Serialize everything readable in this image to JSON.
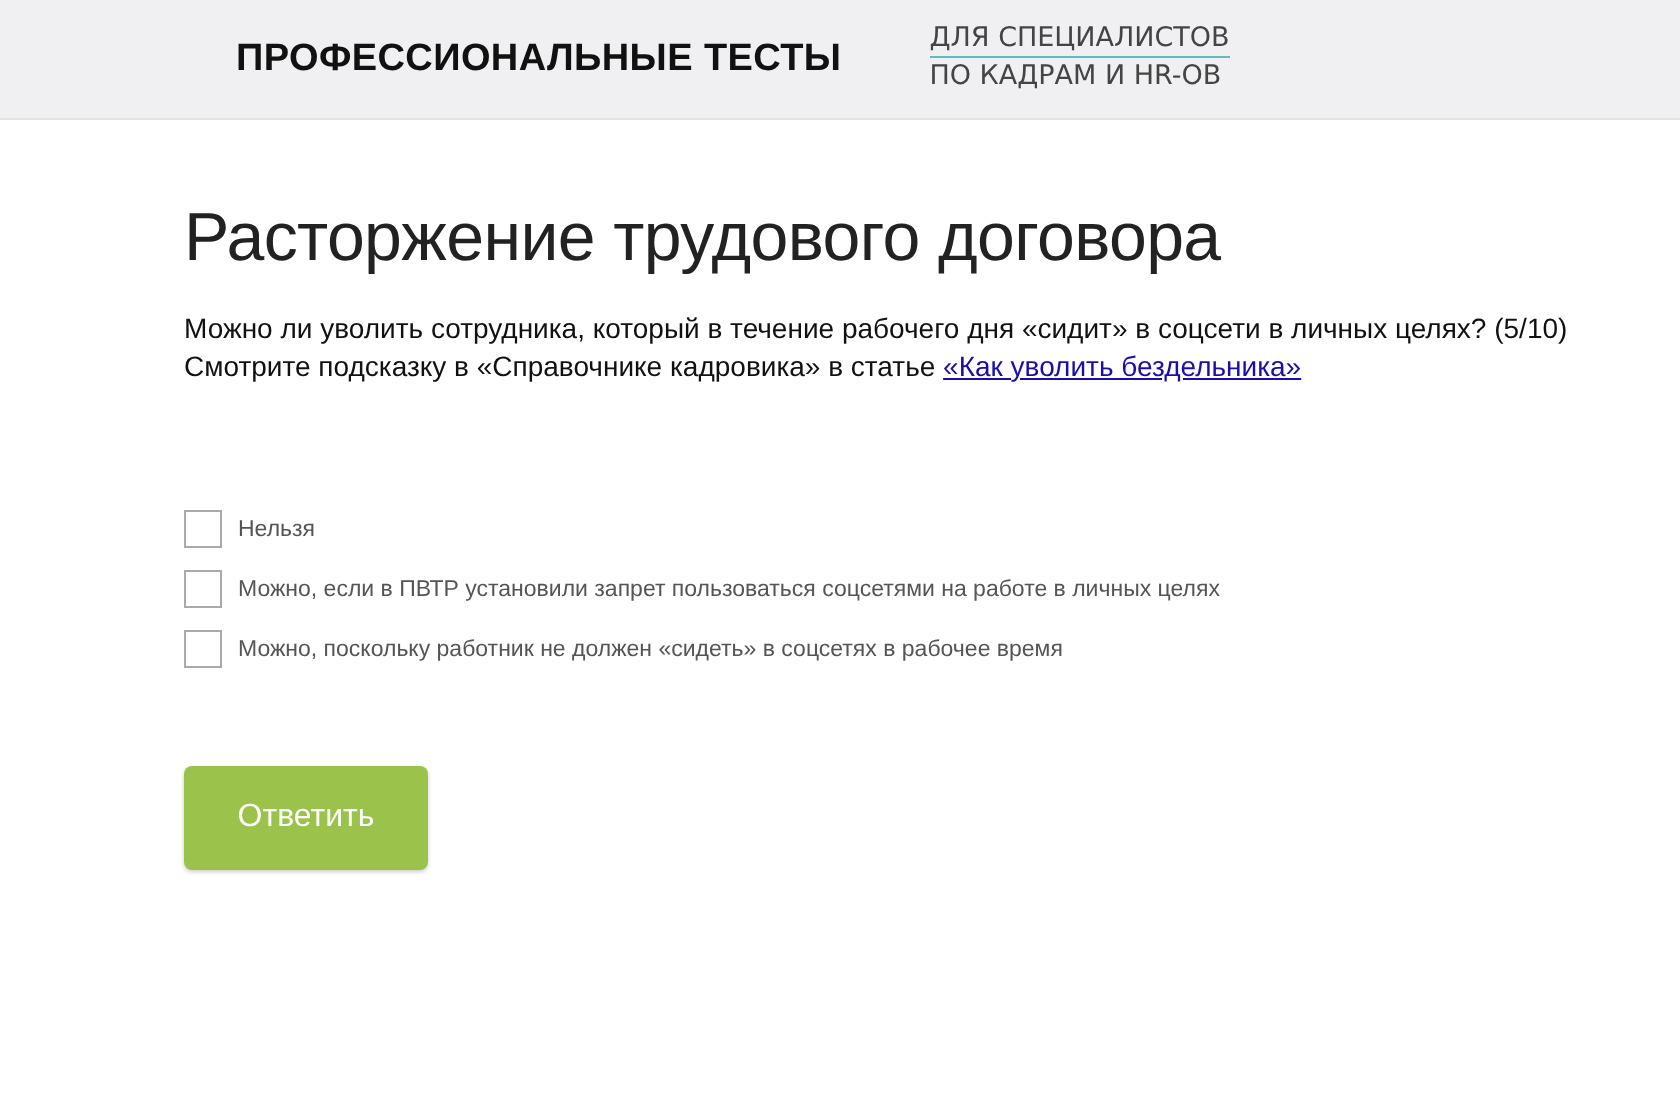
{
  "header": {
    "title": "ПРОФЕССИОНАЛЬНЫЕ ТЕСТЫ",
    "subtitle_lines": [
      "ДЛЯ СПЕЦИАЛИСТОВ",
      "ПО КАДРАМ И HR-ОВ"
    ]
  },
  "test": {
    "title": "Расторжение трудового договора",
    "question": "Можно ли уволить сотрудника, который в течение рабочего дня «сидит» в соцсети в личных целях? (5/10)",
    "hint": "Смотрите подсказку в «Справочнике кадровика» в статье",
    "hint_link": "«Как уволить бездельника»",
    "options": [
      {
        "label": "Нельзя",
        "checked": false
      },
      {
        "label": "Можно, если в ПВТР установили запрет пользоваться соцсетями на работе в личных целях",
        "checked": false
      },
      {
        "label": "Можно, поскольку работник не должен «сидеть» в соцсетях в рабочее время",
        "checked": false
      }
    ],
    "submit": "Ответить"
  }
}
